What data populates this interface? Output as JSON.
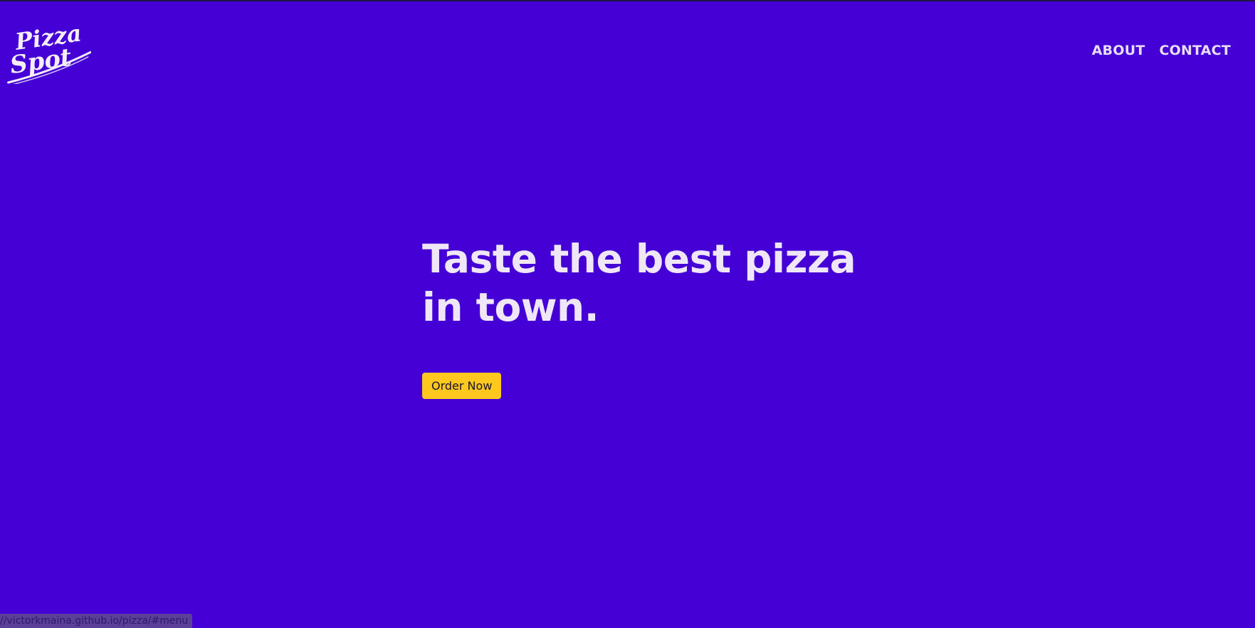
{
  "theme": {
    "background": "#4400d5",
    "accent_button": "#ffc81f",
    "nav_text": "#e8ddf3"
  },
  "brand": {
    "logo_line1": "Pizza",
    "logo_line2": "Spot",
    "logo_icon": "pizza-spot-script-logo"
  },
  "nav": {
    "about_label": "ABOUT",
    "contact_label": "CONTACT"
  },
  "hero": {
    "title_line1": "Taste the best pizza",
    "title_line2": "in town.",
    "cta_label": "Order Now"
  },
  "status_bar": {
    "url": "//victorkmaina.github.io/pizza/#menu"
  }
}
